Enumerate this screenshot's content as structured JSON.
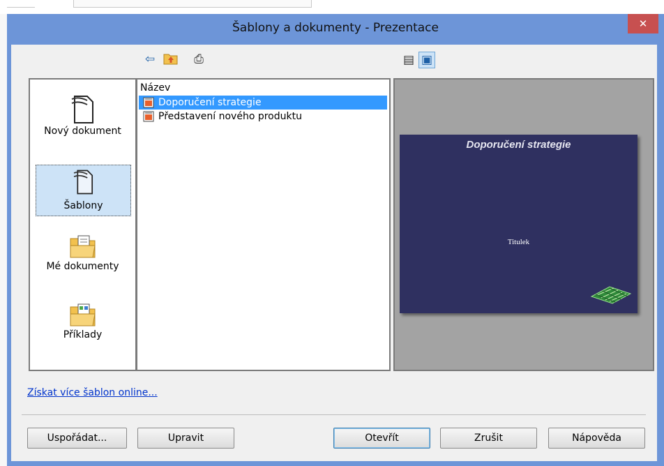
{
  "window": {
    "title": "Šablony a dokumenty - Prezentace",
    "close_glyph": "✕",
    "accent": "#6d95d8"
  },
  "toolbar": {
    "back_icon": "⇦",
    "up_folder_icon": "folder-up-icon",
    "print_icon": "⎙",
    "details_view_icon": "▤",
    "preview_view_icon": "▣"
  },
  "categories": [
    {
      "label": "Nový dokument",
      "icon": "new-document-icon",
      "selected": false
    },
    {
      "label": "Šablony",
      "icon": "templates-icon",
      "selected": true
    },
    {
      "label": "Mé dokumenty",
      "icon": "my-documents-folder-icon",
      "selected": false
    },
    {
      "label": "Příklady",
      "icon": "examples-folder-icon",
      "selected": false
    }
  ],
  "file_list": {
    "column_header": "Název",
    "items": [
      {
        "label": "Doporučení strategie",
        "selected": true
      },
      {
        "label": "Představení nového produktu",
        "selected": false
      }
    ]
  },
  "preview": {
    "slide_title": "Doporučení strategie",
    "slide_subtitle": "Titulek",
    "slide_color": "#2f3060"
  },
  "link": {
    "label": "Získat více šablon online..."
  },
  "buttons": {
    "organize": "Uspořádat...",
    "edit": "Upravit",
    "open": "Otevřít",
    "cancel": "Zrušit",
    "help": "Nápověda"
  }
}
